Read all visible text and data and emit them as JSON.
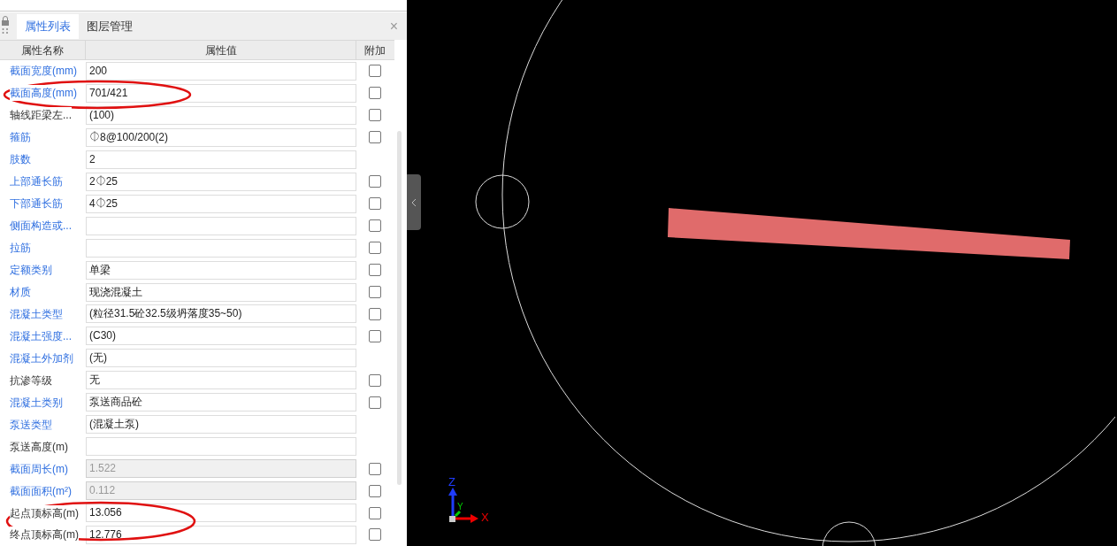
{
  "tabs": [
    {
      "label": "属性列表",
      "selected": true
    },
    {
      "label": "图层管理",
      "selected": false
    }
  ],
  "table": {
    "columns": [
      "属性名称",
      "属性值",
      "附加"
    ],
    "rows": [
      {
        "name": "截面宽度(mm)",
        "linked": true,
        "value": "200",
        "disabled": false,
        "kind": "checkbox",
        "checked": false
      },
      {
        "name": "截面高度(mm)",
        "linked": true,
        "value": "701/421",
        "disabled": false,
        "kind": "checkbox",
        "checked": false
      },
      {
        "name": "轴线距梁左...",
        "linked": false,
        "value": "(100)",
        "disabled": false,
        "kind": "checkbox",
        "checked": false
      },
      {
        "name": "箍筋",
        "linked": true,
        "value": "⏀8@100/200(2)",
        "disabled": false,
        "kind": "checkbox",
        "checked": false
      },
      {
        "name": "肢数",
        "linked": true,
        "value": "2",
        "disabled": false,
        "kind": "none"
      },
      {
        "name": "上部通长筋",
        "linked": true,
        "value": "2⏀25",
        "disabled": false,
        "kind": "checkbox",
        "checked": false
      },
      {
        "name": "下部通长筋",
        "linked": true,
        "value": "4⏀25",
        "disabled": false,
        "kind": "checkbox",
        "checked": false
      },
      {
        "name": "侧面构造或...",
        "linked": true,
        "value": "",
        "disabled": false,
        "kind": "checkbox",
        "checked": false
      },
      {
        "name": "拉筋",
        "linked": true,
        "value": "",
        "disabled": false,
        "kind": "checkbox",
        "checked": false
      },
      {
        "name": "定额类别",
        "linked": true,
        "value": "单梁",
        "disabled": false,
        "kind": "checkbox",
        "checked": false
      },
      {
        "name": "材质",
        "linked": true,
        "value": "现浇混凝土",
        "disabled": false,
        "kind": "checkbox",
        "checked": false
      },
      {
        "name": "混凝土类型",
        "linked": true,
        "value": "(粒径31.5砼32.5级坍落度35~50)",
        "disabled": false,
        "kind": "checkbox",
        "checked": false
      },
      {
        "name": "混凝土强度...",
        "linked": true,
        "value": "(C30)",
        "disabled": false,
        "kind": "checkbox",
        "checked": false
      },
      {
        "name": "混凝土外加剂",
        "linked": true,
        "value": "(无)",
        "disabled": false,
        "kind": "none"
      },
      {
        "name": "抗渗等级",
        "linked": false,
        "value": "无",
        "disabled": false,
        "kind": "checkbox",
        "checked": false
      },
      {
        "name": "混凝土类别",
        "linked": true,
        "value": "泵送商品砼",
        "disabled": false,
        "kind": "checkbox",
        "checked": false
      },
      {
        "name": "泵送类型",
        "linked": true,
        "value": "(混凝土泵)",
        "disabled": false,
        "kind": "none"
      },
      {
        "name": "泵送高度(m)",
        "linked": false,
        "value": "",
        "disabled": false,
        "kind": "none"
      },
      {
        "name": "截面周长(m)",
        "linked": true,
        "value": "1.522",
        "disabled": true,
        "kind": "checkbox",
        "checked": false
      },
      {
        "name": "截面面积(m²)",
        "linked": true,
        "value": "0.112",
        "disabled": true,
        "kind": "checkbox",
        "checked": false
      },
      {
        "name": "起点顶标高(m)",
        "linked": false,
        "value": "13.056",
        "disabled": false,
        "kind": "checkbox",
        "checked": false
      },
      {
        "name": "终点顶标高(m)",
        "linked": false,
        "value": "12.776",
        "disabled": false,
        "kind": "checkbox",
        "checked": false
      }
    ]
  },
  "axes": {
    "z": "Z",
    "y": "Y",
    "x": "X"
  },
  "close_glyph": "×"
}
